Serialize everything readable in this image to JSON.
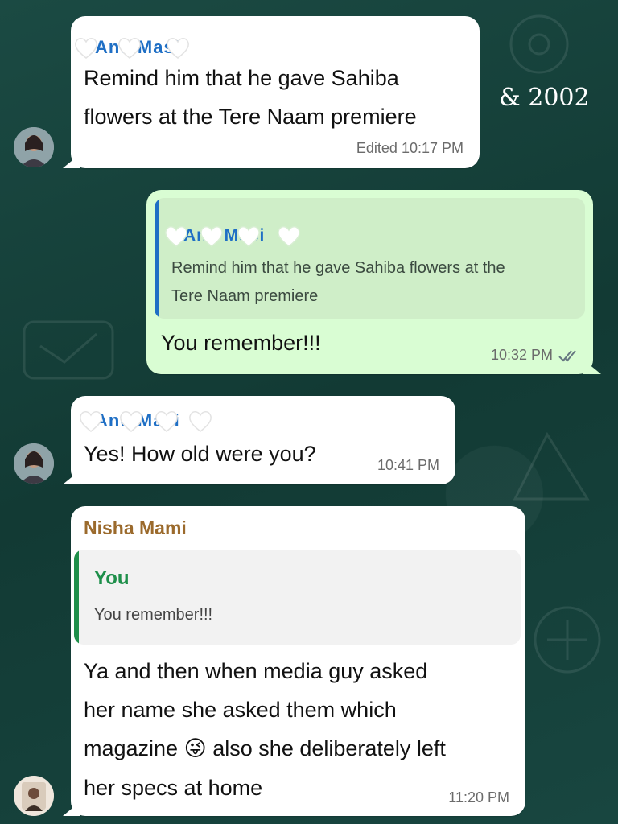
{
  "overlay_text": "& 2002",
  "messages": [
    {
      "sender": "Anu Masi",
      "text_line1": "Remind him that he gave Sahiba",
      "text_line2": "flowers at the Tere Naam premiere",
      "edited_label": "Edited",
      "time": "10:17 PM"
    },
    {
      "quote_sender": "Anu Masi",
      "quote_line1": "Remind him that he gave Sahiba flowers at the",
      "quote_line2": "Tere Naam premiere",
      "text": "You remember!!!",
      "time": "10:32 PM",
      "status_icon": "double-check-icon"
    },
    {
      "sender": "Anu Masi",
      "text": "Yes! How old were you?",
      "time": "10:41 PM"
    },
    {
      "sender": "Nisha Mami",
      "quote_sender": "You",
      "quote_text": "You remember!!!",
      "text_line1": "Ya and then when media guy asked",
      "text_line2": "her name she asked them which",
      "text_line3_a": "magazine",
      "emoji": "😜",
      "text_line3_b": "also she deliberately left",
      "text_line4": "her specs at home",
      "time": "11:20 PM"
    }
  ],
  "colors": {
    "anu_name": "#1f6fc5",
    "nisha_name": "#9b6a2c",
    "you_name": "#1e8f4a",
    "outgoing_bubble": "#d9fdd3",
    "incoming_bubble": "#ffffff",
    "wallpaper": "#16423c"
  }
}
